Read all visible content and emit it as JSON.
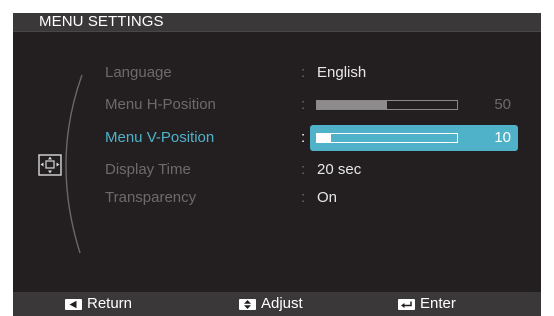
{
  "window": {
    "title": "MENU SETTINGS"
  },
  "menu": {
    "icon": "menu-settings-icon",
    "items": [
      {
        "label": "Language",
        "value": "English",
        "type": "text",
        "active": false
      },
      {
        "label": "Menu H-Position",
        "value": "50",
        "type": "slider",
        "level": 0.5,
        "active": false
      },
      {
        "label": "Menu V-Position",
        "value": "10",
        "type": "slider",
        "level": 0.1,
        "active": true
      },
      {
        "label": "Display Time",
        "value": "20 sec",
        "type": "text",
        "active": false
      },
      {
        "label": "Transparency",
        "value": "On",
        "type": "text",
        "active": false
      }
    ],
    "separator": ":"
  },
  "footer": {
    "return_label": "Return",
    "return_icon": "left-triangle-key-icon",
    "adjust_label": "Adjust",
    "adjust_icon": "up-down-key-icon",
    "enter_label": "Enter",
    "enter_icon": "enter-arrow-key-icon"
  },
  "colors": {
    "background": "#231f20",
    "bar": "#3b3839",
    "accent": "#4fb2c9",
    "inactive_text": "#6d6a6b",
    "value_text": "#e6e6e6"
  }
}
